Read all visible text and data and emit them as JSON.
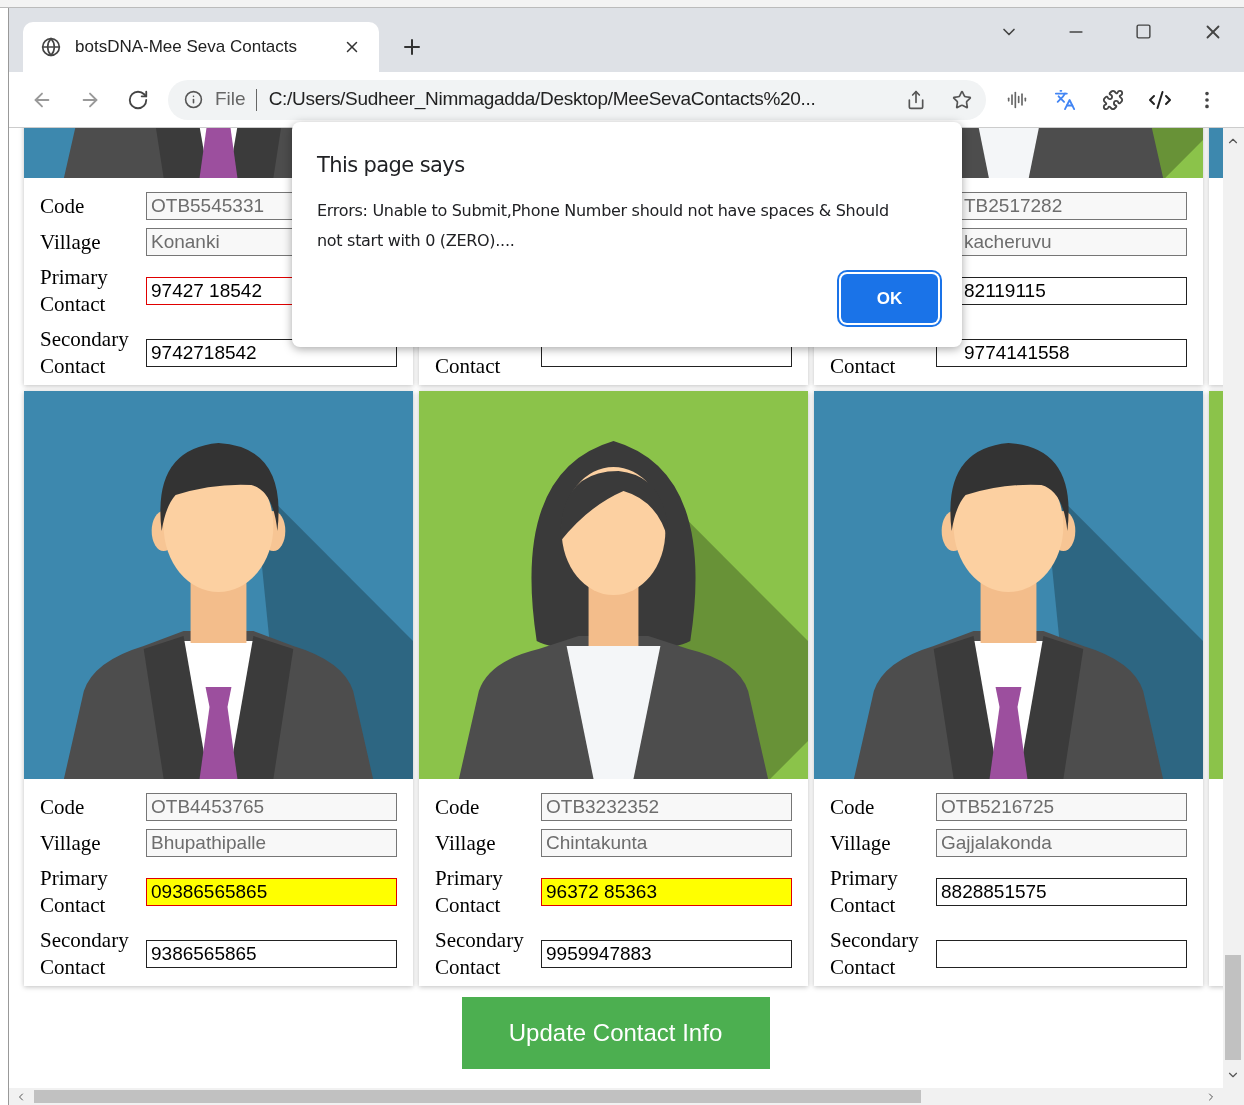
{
  "browser": {
    "tab_title": "botsDNA-Mee Seva Contacts",
    "scheme_label": "File",
    "url": "C:/Users/Sudheer_Nimmagadda/Desktop/MeeSevaContacts%20..."
  },
  "cards": [
    {
      "photo": {
        "kind": "male",
        "color": "#3d88ae"
      },
      "fields": [
        {
          "label": "Code",
          "value": "OTB5545331",
          "kind": "readonly",
          "error": false,
          "highlighted": false
        },
        {
          "label": "Village",
          "value": "Konanki",
          "kind": "readonly",
          "error": false,
          "highlighted": false
        },
        {
          "label": "Primary Contact",
          "value": "97427 18542",
          "kind": "editable",
          "error": true,
          "highlighted": false
        },
        {
          "label": "Secondary Contact",
          "value": "9742718542",
          "kind": "editable",
          "error": false,
          "highlighted": false
        }
      ]
    },
    {
      "fields": [
        {
          "label": "Contact",
          "kind": "editable",
          "error": false,
          "highlighted": false
        }
      ]
    },
    {
      "photo": {
        "kind": "female",
        "color": "#8bc34a"
      },
      "fields": [
        {
          "value": "TB2517282",
          "kind": "readonly",
          "error": false,
          "highlighted": false
        },
        {
          "value": "kacheruvu",
          "kind": "readonly",
          "error": false,
          "highlighted": false
        },
        {
          "value": "82119115",
          "kind": "editable",
          "error": false,
          "highlighted": false
        },
        {
          "label": "Contact",
          "value": "9774141558",
          "kind": "editable",
          "error": false,
          "highlighted": false
        }
      ]
    },
    {
      "photo": {
        "color": "#3d88ae"
      }
    },
    {
      "photo": {
        "kind": "male",
        "color": "#3d88ae"
      },
      "fields": [
        {
          "label": "Code",
          "value": "OTB4453765",
          "kind": "readonly",
          "error": false,
          "highlighted": false
        },
        {
          "label": "Village",
          "value": "Bhupathipalle",
          "kind": "readonly",
          "error": false,
          "highlighted": false
        },
        {
          "label": "Primary Contact",
          "value": "09386565865",
          "kind": "editable",
          "error": true,
          "highlighted": true
        },
        {
          "label": "Secondary Contact",
          "value": "9386565865",
          "kind": "editable",
          "error": false,
          "highlighted": false
        }
      ]
    },
    {
      "photo": {
        "kind": "female",
        "color": "#8bc34a"
      },
      "fields": [
        {
          "label": "Code",
          "value": "OTB3232352",
          "kind": "readonly",
          "error": false,
          "highlighted": false
        },
        {
          "label": "Village",
          "value": "Chintakunta",
          "kind": "readonly",
          "error": false,
          "highlighted": false
        },
        {
          "label": "Primary Contact",
          "value": "96372 85363",
          "kind": "editable",
          "error": true,
          "highlighted": true
        },
        {
          "label": "Secondary Contact",
          "value": "9959947883",
          "kind": "editable",
          "error": false,
          "highlighted": false
        }
      ]
    },
    {
      "photo": {
        "kind": "male",
        "color": "#3d88ae"
      },
      "fields": [
        {
          "label": "Code",
          "value": "OTB5216725",
          "kind": "readonly",
          "error": false,
          "highlighted": false
        },
        {
          "label": "Village",
          "value": "Gajjalakonda",
          "kind": "readonly",
          "error": false,
          "highlighted": false
        },
        {
          "label": "Primary Contact",
          "value": "8828851575",
          "kind": "editable",
          "error": false,
          "highlighted": false
        },
        {
          "label": "Secondary Contact",
          "kind": "editable",
          "error": false,
          "highlighted": false
        }
      ]
    },
    {
      "photo": {
        "color": "#8bc34a"
      }
    }
  ],
  "update_button": "Update Contact Info",
  "dialog": {
    "title": "This page says",
    "message": "Errors: Unable to Submit,Phone Number should not have spaces & Should not start with 0 (ZERO)....",
    "button": "OK"
  }
}
